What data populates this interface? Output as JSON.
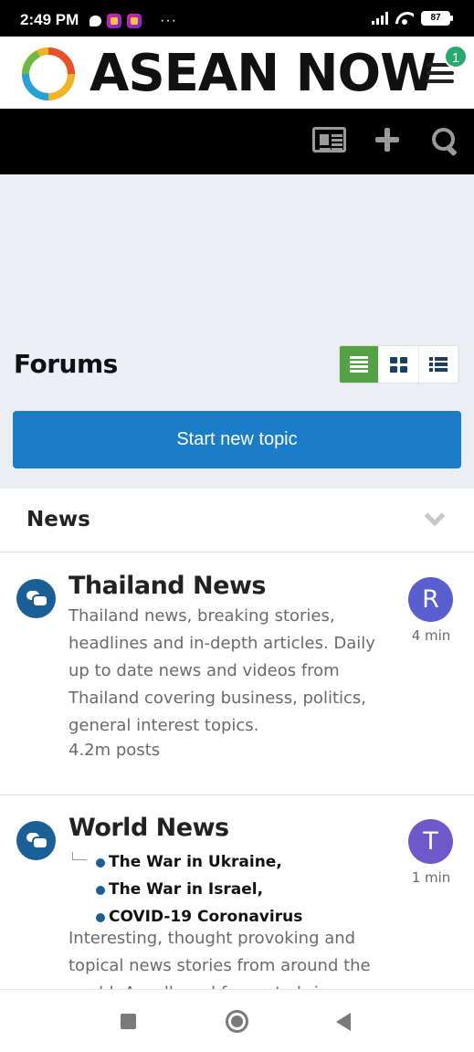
{
  "status_bar": {
    "time": "2:49 PM",
    "ellipsis": "···",
    "battery": "87"
  },
  "header": {
    "logo_text": "ASEAN NOW",
    "notification_count": "1"
  },
  "page": {
    "title": "Forums",
    "start_topic_label": "Start new topic"
  },
  "section": {
    "title": "News"
  },
  "forums": [
    {
      "title": "Thailand News",
      "description": "Thailand news, breaking stories, headlines and in-depth articles. Daily up to date news and videos from Thailand covering business, politics, general interest topics.",
      "post_count": "4.2m posts",
      "last_poster_initial": "R",
      "last_time": "4 min"
    },
    {
      "title": "World News",
      "subforums": [
        "The War in Ukraine,",
        "The War in Israel,",
        "COVID-19 Coronavirus"
      ],
      "description": "Interesting, thought provoking and topical news stories from around the world. A well read forum to bring your thoughts on",
      "last_poster_initial": "T",
      "last_time": "1 min"
    }
  ],
  "colors": {
    "accent_blue": "#1b7cc8",
    "active_view_green": "#55a145",
    "forum_icon_blue": "#1b5f97",
    "badge_green": "#2aa86e"
  },
  "icons": {
    "view_toggles": [
      "list-lines-icon",
      "grid-icon",
      "list-bullets-icon"
    ],
    "action_bar": [
      "newspaper-icon",
      "plus-icon",
      "search-icon"
    ]
  }
}
